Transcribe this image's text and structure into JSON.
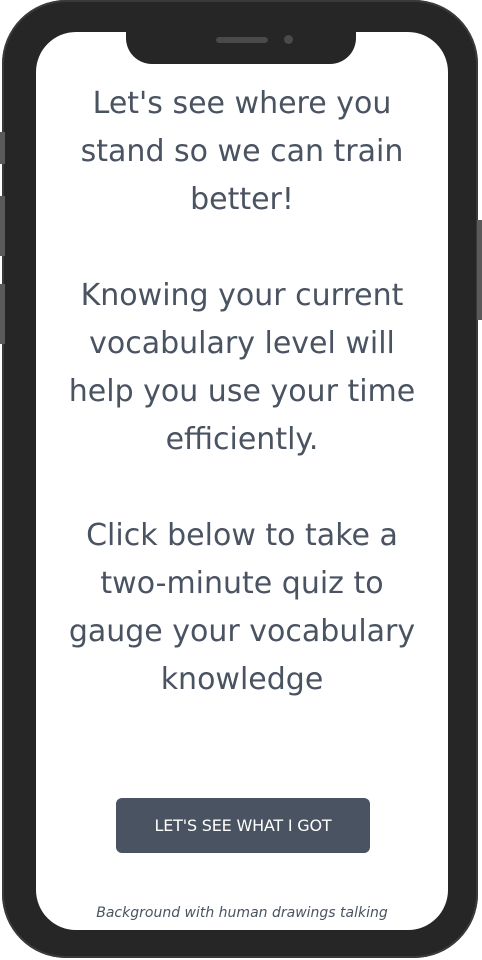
{
  "screen": {
    "paragraphs": [
      "Let's see where you stand so we can train better!",
      "Knowing your current vocabulary level will help you use your time efficiently.",
      "Click below to take a two-minute quiz to gauge your vocabulary knowledge"
    ],
    "cta_label": "LET'S SEE WHAT I GOT",
    "footnote": "Background with human drawings talking"
  },
  "colors": {
    "text": "#4a5361",
    "button_bg": "#4a5361",
    "button_text": "#ffffff",
    "frame": "#262626"
  }
}
